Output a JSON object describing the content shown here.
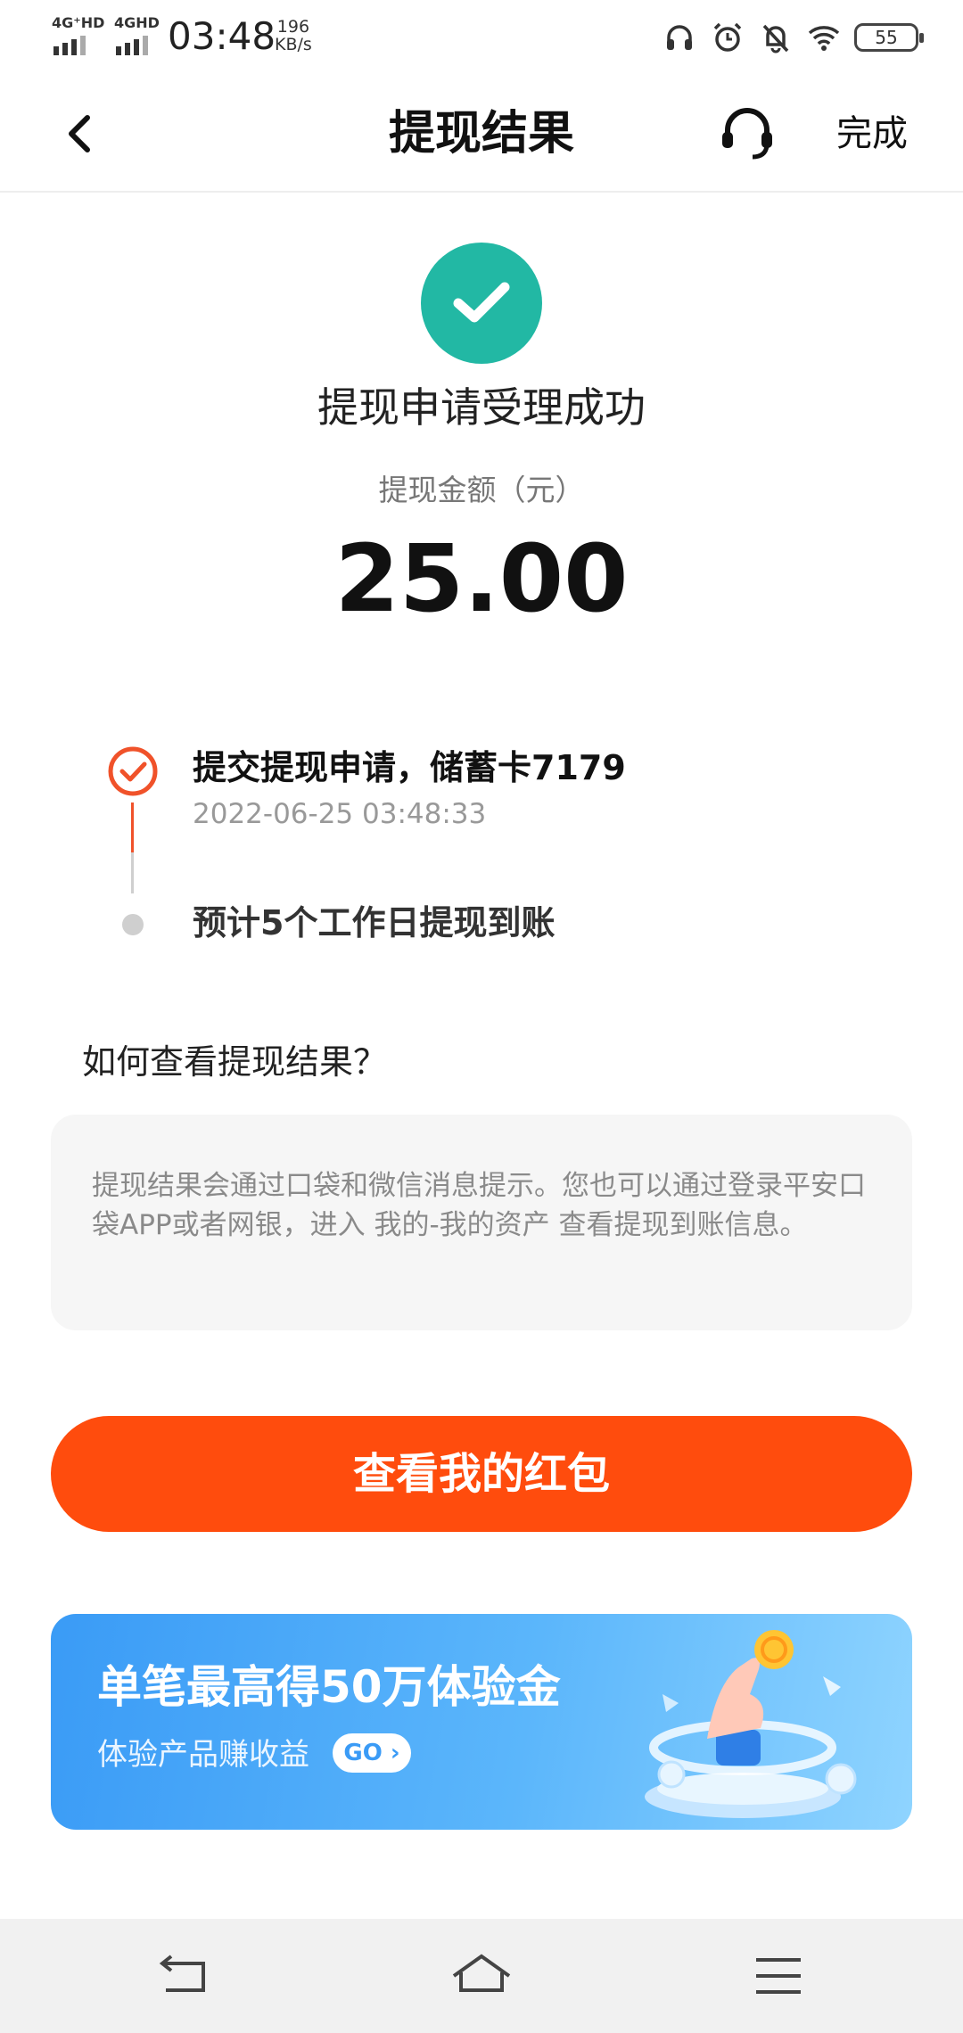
{
  "status_bar": {
    "signal_1": "4G⁺HD",
    "signal_2": "4GHD",
    "time": "03:48",
    "net_speed_value": "196",
    "net_speed_unit": "KB/s",
    "battery": "55",
    "icons": [
      "headphones-icon",
      "alarm-icon",
      "bell-off-icon",
      "wifi-icon",
      "battery-icon"
    ]
  },
  "nav": {
    "title": "提现结果",
    "done": "完成",
    "back_icon": "chevron-left-icon",
    "support_icon": "headset-icon"
  },
  "result": {
    "status_text": "提现申请受理成功",
    "amount_label": "提现金额（元）",
    "amount": "25.00",
    "success_color": "#22b8a4"
  },
  "timeline": {
    "step1_title": "提交提现申请，储蓄卡7179",
    "step1_time": "2022-06-25 03:48:33",
    "step2_title": "预计5个工作日提现到账",
    "active_color": "#f0522a"
  },
  "info": {
    "heading": "如何查看提现结果？",
    "body": "提现结果会通过口袋和微信消息提示。您也可以通过登录平安口袋APP或者网银，进入 我的-我的资产 查看提现到账信息。"
  },
  "cta": {
    "label": "查看我的红包",
    "color": "#ff4c0d"
  },
  "banner": {
    "title": "单笔最高得50万体验金",
    "subtitle": "体验产品赚收益",
    "go": "GO"
  },
  "system_nav": {
    "buttons": [
      "back-nav-icon",
      "home-nav-icon",
      "menu-nav-icon"
    ]
  }
}
